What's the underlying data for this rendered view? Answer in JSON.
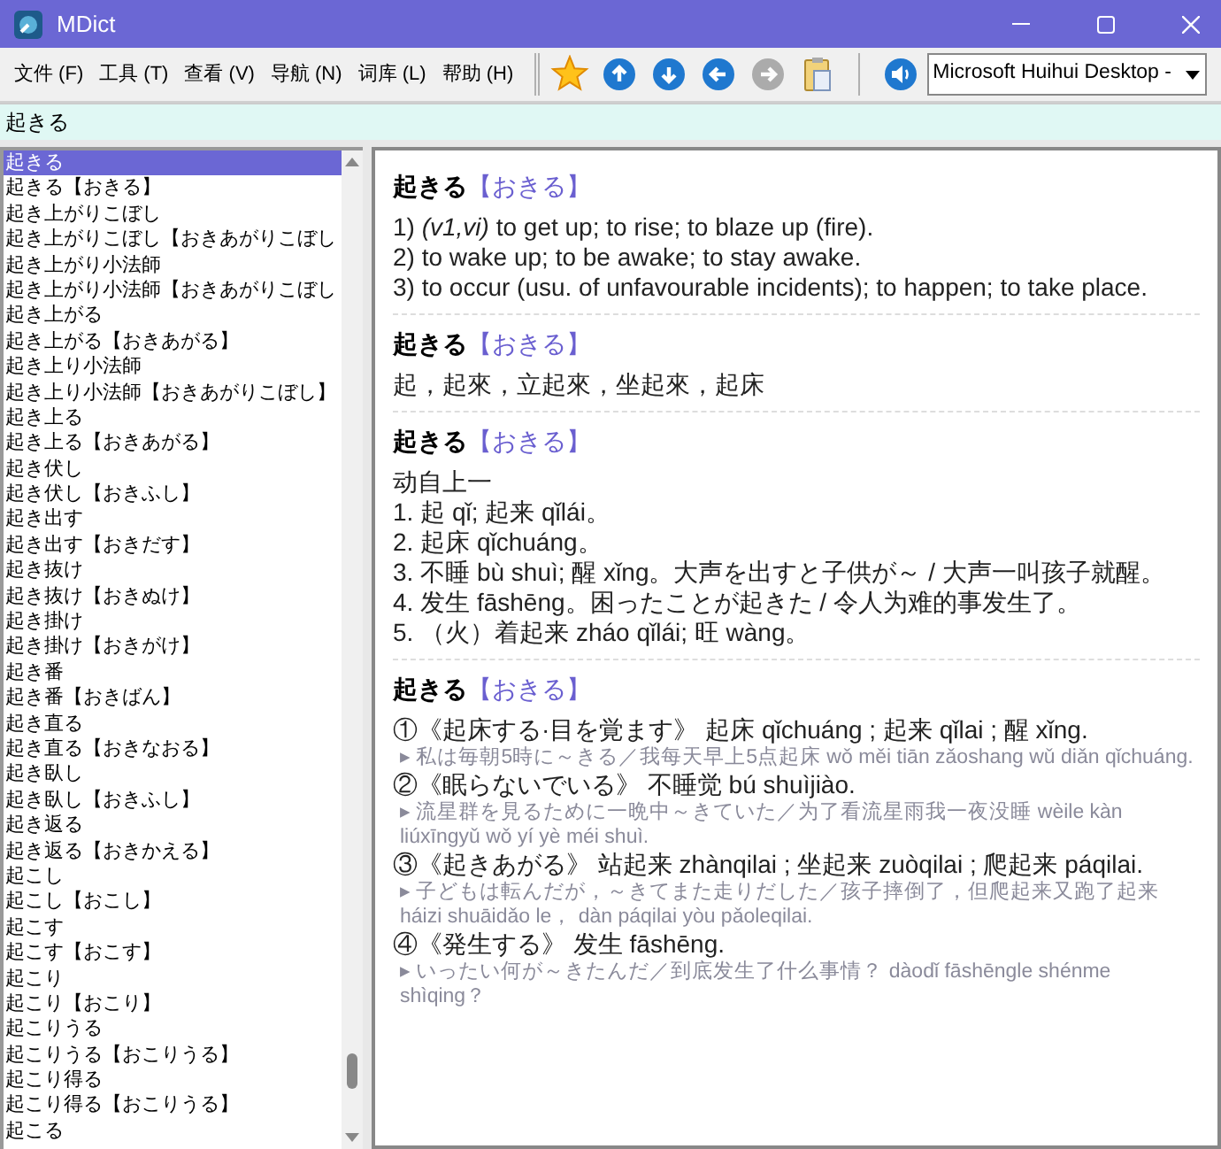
{
  "window": {
    "title": "MDict"
  },
  "menu": [
    {
      "label": "文件 (F)"
    },
    {
      "label": "工具 (T)"
    },
    {
      "label": "查看 (V)"
    },
    {
      "label": "导航 (N)"
    },
    {
      "label": "词库 (L)"
    },
    {
      "label": "帮助 (H)"
    }
  ],
  "toolbar": [
    {
      "kind": "star",
      "disabled": false
    },
    {
      "kind": "up",
      "disabled": false
    },
    {
      "kind": "down",
      "disabled": false
    },
    {
      "kind": "back",
      "disabled": false
    },
    {
      "kind": "forward",
      "disabled": true
    },
    {
      "kind": "clipboard",
      "disabled": false
    },
    {
      "kind": "speaker",
      "disabled": false
    }
  ],
  "voice_select": {
    "value": "Microsoft Huihui Desktop -"
  },
  "search": {
    "value": "起きる"
  },
  "word_list": [
    {
      "label": "起きる",
      "selected": true
    },
    {
      "label": "起きる【おきる】",
      "selected": false
    },
    {
      "label": "起き上がりこぼし",
      "selected": false
    },
    {
      "label": "起き上がりこぼし【おきあがりこぼし",
      "selected": false
    },
    {
      "label": "起き上がり小法師",
      "selected": false
    },
    {
      "label": "起き上がり小法師【おきあがりこぼし",
      "selected": false
    },
    {
      "label": "起き上がる",
      "selected": false
    },
    {
      "label": "起き上がる【おきあがる】",
      "selected": false
    },
    {
      "label": "起き上り小法師",
      "selected": false
    },
    {
      "label": "起き上り小法師【おきあがりこぼし】",
      "selected": false
    },
    {
      "label": "起き上る",
      "selected": false
    },
    {
      "label": "起き上る【おきあがる】",
      "selected": false
    },
    {
      "label": "起き伏し",
      "selected": false
    },
    {
      "label": "起き伏し【おきふし】",
      "selected": false
    },
    {
      "label": "起き出す",
      "selected": false
    },
    {
      "label": "起き出す【おきだす】",
      "selected": false
    },
    {
      "label": "起き抜け",
      "selected": false
    },
    {
      "label": "起き抜け【おきぬけ】",
      "selected": false
    },
    {
      "label": "起き掛け",
      "selected": false
    },
    {
      "label": "起き掛け【おきがけ】",
      "selected": false
    },
    {
      "label": "起き番",
      "selected": false
    },
    {
      "label": "起き番【おきばん】",
      "selected": false
    },
    {
      "label": "起き直る",
      "selected": false
    },
    {
      "label": "起き直る【おきなおる】",
      "selected": false
    },
    {
      "label": "起き臥し",
      "selected": false
    },
    {
      "label": "起き臥し【おきふし】",
      "selected": false
    },
    {
      "label": "起き返る",
      "selected": false
    },
    {
      "label": "起き返る【おきかえる】",
      "selected": false
    },
    {
      "label": "起こし",
      "selected": false
    },
    {
      "label": "起こし【おこし】",
      "selected": false
    },
    {
      "label": "起こす",
      "selected": false
    },
    {
      "label": "起こす【おこす】",
      "selected": false
    },
    {
      "label": "起こり",
      "selected": false
    },
    {
      "label": "起こり【おこり】",
      "selected": false
    },
    {
      "label": "起こりうる",
      "selected": false
    },
    {
      "label": "起こりうる【おこりうる】",
      "selected": false
    },
    {
      "label": "起こり得る",
      "selected": false
    },
    {
      "label": "起こり得る【おこりうる】",
      "selected": false
    },
    {
      "label": "起こる",
      "selected": false
    }
  ],
  "entries": [
    {
      "headword": "起きる",
      "reading": "【おきる】",
      "lines": [
        {
          "kind": "sense",
          "text": "1) *(v1,vi)* to get up; to rise; to blaze up (fire)."
        },
        {
          "kind": "sense",
          "text": "2) to wake up; to be awake; to stay awake."
        },
        {
          "kind": "sense",
          "text": "3) to occur (usu. of unfavourable incidents); to happen; to take place."
        }
      ]
    },
    {
      "headword": "起きる",
      "reading": "【おきる】",
      "lines": [
        {
          "kind": "sense",
          "text": "起，起來，立起來，坐起來，起床"
        }
      ]
    },
    {
      "headword": "起きる",
      "reading": "【おきる】",
      "lines": [
        {
          "kind": "sense",
          "text": "动自上一"
        },
        {
          "kind": "sense",
          "text": "1. 起 qǐ; 起来 qǐlái。"
        },
        {
          "kind": "sense",
          "text": "2. 起床 qǐchuáng。"
        },
        {
          "kind": "sense",
          "text": "3. 不睡 bù shuì; 醒 xǐng。大声を出すと子供が～ / 大声一叫孩子就醒。"
        },
        {
          "kind": "sense",
          "text": "4. 发生 fāshēng。困ったことが起きた / 令人为难的事发生了。"
        },
        {
          "kind": "sense",
          "text": "5. （火）着起来 zháo qǐlái; 旺 wàng。"
        }
      ]
    },
    {
      "headword": "起きる",
      "reading": "【おきる】",
      "lines": [
        {
          "kind": "sense",
          "text": "①《起床する·目を覚ます》 起床 qǐchuáng ; 起来 qǐlai ; 醒 xǐng."
        },
        {
          "kind": "example",
          "text": "▸ 私は毎朝5時に～きる／我每天早上5点起床 wǒ měi tiān zǎoshang wǔ diǎn qǐchuáng."
        },
        {
          "kind": "sense",
          "text": "②《眠らないでいる》 不睡觉 bú shuìjiào."
        },
        {
          "kind": "example",
          "text": "▸ 流星群を見るために一晩中～きていた／为了看流星雨我一夜没睡 wèile kàn liúxīngyǔ wǒ yí yè méi shuì."
        },
        {
          "kind": "sense",
          "text": "③《起きあがる》 站起来 zhànqilai ; 坐起来 zuòqilai ; 爬起来 páqilai."
        },
        {
          "kind": "example",
          "text": "▸ 子どもは転んだが，～きてまた走りだした／孩子摔倒了，但爬起来又跑了起来 háizi shuāidǎo le， dàn páqilai yòu pǎoleqilai."
        },
        {
          "kind": "sense",
          "text": "④《発生する》 发生 fāshēng."
        },
        {
          "kind": "example",
          "text": "▸ いったい何が～きたんだ／到底发生了什么事情？ dàodǐ fāshēngle shénme shìqing？"
        }
      ]
    }
  ]
}
